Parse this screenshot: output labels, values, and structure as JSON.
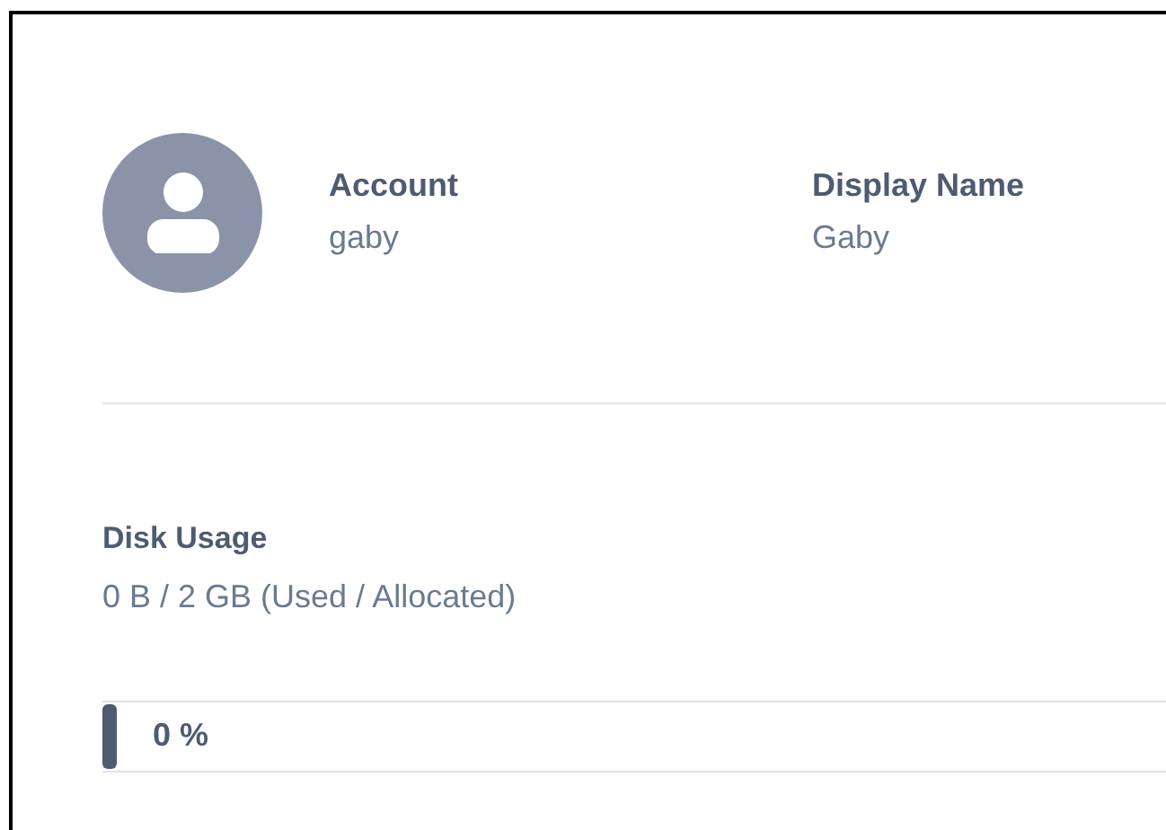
{
  "profile": {
    "fields": [
      {
        "label": "Account",
        "value": "gaby"
      },
      {
        "label": "Display Name",
        "value": "Gaby"
      }
    ]
  },
  "disk_usage": {
    "label": "Disk Usage",
    "value": "0 B / 2 GB (Used / Allocated)",
    "level": 0,
    "reading": "0 %"
  }
}
